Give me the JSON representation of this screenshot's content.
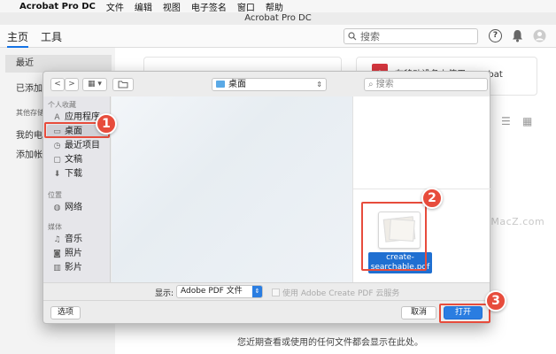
{
  "menubar": {
    "app_name": "Acrobat Pro DC",
    "items": [
      "文件",
      "编辑",
      "视图",
      "电子签名",
      "窗口",
      "帮助"
    ]
  },
  "window": {
    "title": "Acrobat Pro DC"
  },
  "toolbar": {
    "tabs": [
      "主页",
      "工具"
    ],
    "search_placeholder": "搜索",
    "help_icon": "?"
  },
  "leftnav": {
    "items": [
      "最近",
      "已添加星"
    ],
    "section_label": "其他存储",
    "storage_items": [
      "我的电脑",
      "添加帐户"
    ]
  },
  "background": {
    "card_text": "在移动设备上使用 Acrobat",
    "empty_text": "您近期查看或使用的任何文件都会显示在此处。"
  },
  "watermark": {
    "prefix": "z",
    "text": "www.MacZ.com"
  },
  "dialog": {
    "nav_back": "<",
    "nav_forward": ">",
    "view_mode": "▦ ▾",
    "location": "桌面",
    "search_placeholder": "搜索",
    "sidebar": {
      "favorites_label": "个人收藏",
      "favorites": [
        {
          "icon": "A",
          "label": "应用程序"
        },
        {
          "icon": "▭",
          "label": "桌面"
        },
        {
          "icon": "◷",
          "label": "最近项目"
        },
        {
          "icon": "▢",
          "label": "文稿"
        },
        {
          "icon": "⬇",
          "label": "下载"
        }
      ],
      "locations_label": "位置",
      "locations": [
        {
          "icon": "◍",
          "label": "网络"
        }
      ],
      "media_label": "媒体",
      "media": [
        {
          "icon": "♫",
          "label": "音乐"
        },
        {
          "icon": "◙",
          "label": "照片"
        },
        {
          "icon": "▥",
          "label": "影片"
        }
      ]
    },
    "file": {
      "name_line1": "create-",
      "name_line2": "searchable.pdf"
    },
    "format_label": "显示:",
    "format_value": "Adobe PDF 文件",
    "cloud_option": "使用 Adobe Create PDF 云服务",
    "options_button": "选项",
    "cancel_button": "取消",
    "open_button": "打开"
  },
  "annotations": [
    "1",
    "2",
    "3"
  ],
  "colors": {
    "accent": "#2a7de1",
    "annotation": "#e74c3c"
  }
}
